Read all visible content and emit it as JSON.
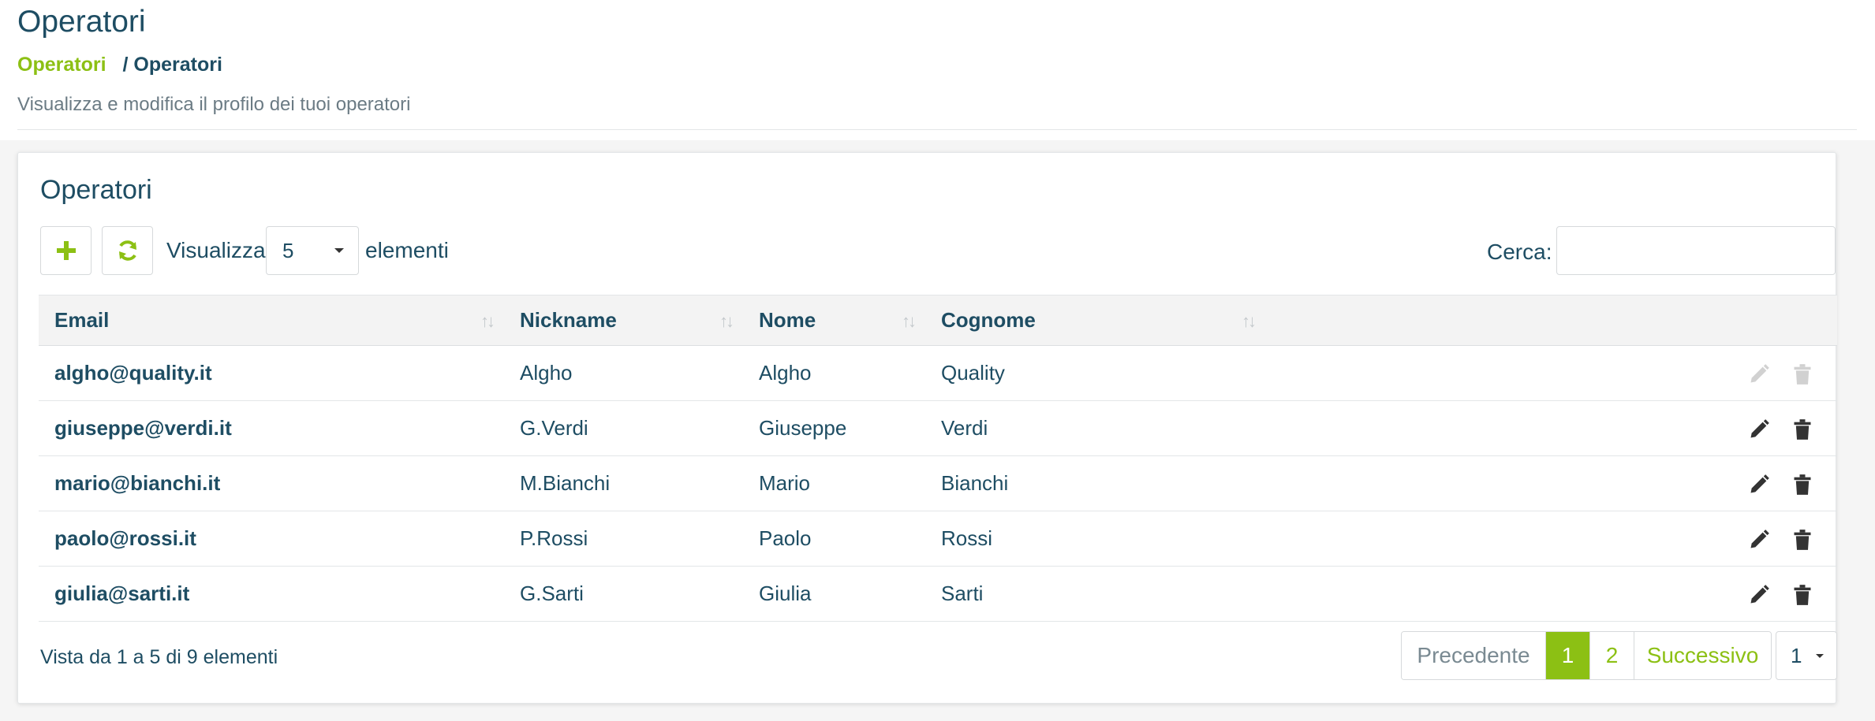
{
  "header": {
    "title": "Operatori",
    "breadcrumb": {
      "link": "Operatori",
      "separator": "/",
      "current": "Operatori"
    },
    "description": "Visualizza e modifica il profilo dei tuoi operatori"
  },
  "card": {
    "title": "Operatori",
    "toolbar": {
      "add_icon": "plus-icon",
      "refresh_icon": "refresh-icon",
      "length_label_pre": "Visualizza",
      "length_value": "5",
      "length_label_post": "elementi",
      "search_label": "Cerca:",
      "search_value": ""
    },
    "table": {
      "columns": [
        "Email",
        "Nickname",
        "Nome",
        "Cognome"
      ],
      "rows": [
        {
          "email": "algho@quality.it",
          "nickname": "Algho",
          "nome": "Algho",
          "cognome": "Quality",
          "actions_enabled": false
        },
        {
          "email": "giuseppe@verdi.it",
          "nickname": "G.Verdi",
          "nome": "Giuseppe",
          "cognome": "Verdi",
          "actions_enabled": true
        },
        {
          "email": "mario@bianchi.it",
          "nickname": "M.Bianchi",
          "nome": "Mario",
          "cognome": "Bianchi",
          "actions_enabled": true
        },
        {
          "email": "paolo@rossi.it",
          "nickname": "P.Rossi",
          "nome": "Paolo",
          "cognome": "Rossi",
          "actions_enabled": true
        },
        {
          "email": "giulia@sarti.it",
          "nickname": "G.Sarti",
          "nome": "Giulia",
          "cognome": "Sarti",
          "actions_enabled": true
        }
      ]
    },
    "footer": {
      "info": "Vista da 1 a 5 di 9 elementi",
      "pagination": {
        "previous": "Precedente",
        "pages": [
          "1",
          "2"
        ],
        "active_page": "1",
        "next": "Successivo"
      },
      "page_jump_value": "1"
    }
  },
  "colors": {
    "accent": "#8cc014",
    "text": "#1e4d63",
    "muted": "#6b7b84"
  }
}
